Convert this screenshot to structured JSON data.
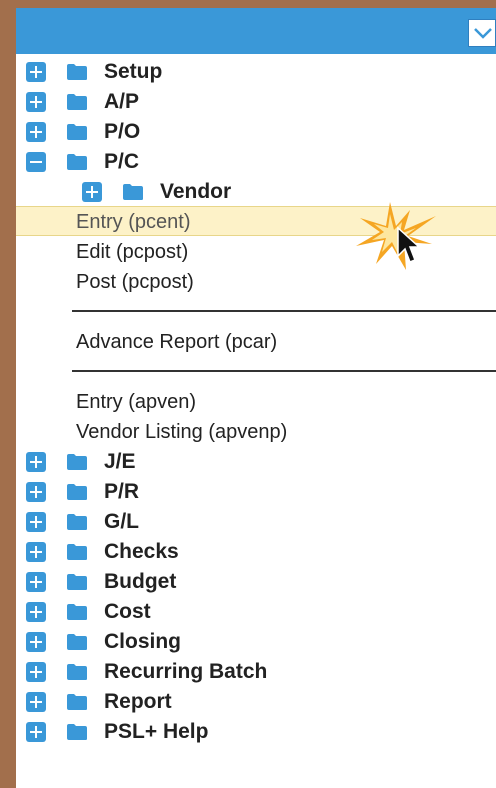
{
  "colors": {
    "frame": "#a26f4c",
    "titlebar": "#3a98d8",
    "icon": "#3a98d8",
    "highlight": "#fdf2c8"
  },
  "dropdown": {
    "icon": "chevron-down-icon"
  },
  "tree": {
    "top": [
      "Setup",
      "A/P",
      "P/O"
    ],
    "pc": {
      "label": "P/C",
      "vendor": "Vendor"
    },
    "pc_items": {
      "entry": "Entry (pcent)",
      "edit": "Edit (pcpost)",
      "post": "Post (pcpost)",
      "advance": "Advance Report (pcar)",
      "apven": "Entry (apven)",
      "apvenp": "Vendor Listing (apvenp)"
    },
    "bottom": [
      "J/E",
      "P/R",
      "G/L",
      "Checks",
      "Budget",
      "Cost",
      "Closing",
      "Recurring Batch",
      "Report",
      "PSL+ Help"
    ]
  }
}
